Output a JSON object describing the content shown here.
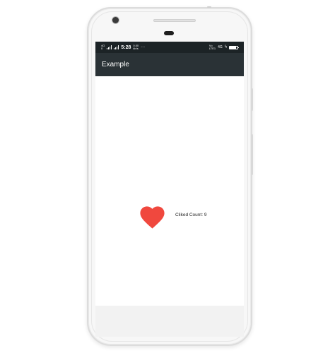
{
  "status_bar": {
    "network_top": "4G",
    "network_bottom": "0",
    "time": "5:28",
    "speed_value": "0.00",
    "speed_unit": "kb/s",
    "more": "···",
    "volte_top": "Vo",
    "volte_bottom": "LTE1",
    "network_right": "4G",
    "battery_icon": "battery-icon",
    "bolt": "ϟ"
  },
  "app_bar": {
    "title": "Example"
  },
  "content": {
    "heart_icon": "heart-icon",
    "heart_color": "#f0483e",
    "count_text": "Cliked Count: 9"
  },
  "colors": {
    "status_bar_bg": "#1c2326",
    "app_bar_bg": "#2a3236",
    "screen_bg": "#ffffff"
  }
}
